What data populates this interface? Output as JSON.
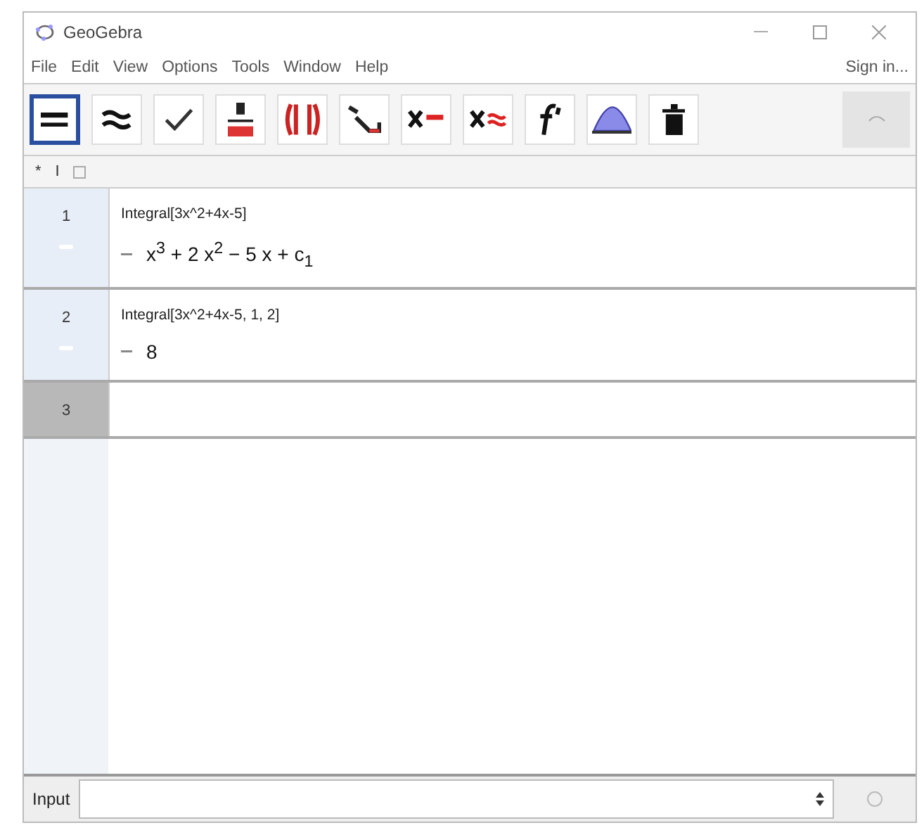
{
  "window": {
    "title": "GeoGebra"
  },
  "menu": [
    "File",
    "Edit",
    "View",
    "Options",
    "Tools",
    "Window",
    "Help"
  ],
  "sign_in": "Sign in...",
  "toolbar": [
    {
      "kind": "evaluate",
      "selected": true
    },
    {
      "kind": "numeric",
      "selected": false
    },
    {
      "kind": "keep",
      "selected": false
    },
    {
      "kind": "factor",
      "selected": false
    },
    {
      "kind": "expand",
      "selected": false
    },
    {
      "kind": "substitute",
      "selected": false
    },
    {
      "kind": "solve",
      "selected": false
    },
    {
      "kind": "nsolve",
      "selected": false
    },
    {
      "kind": "derivative",
      "selected": false
    },
    {
      "kind": "integral",
      "selected": false
    },
    {
      "kind": "delete",
      "selected": false
    }
  ],
  "format_bar": [
    "*",
    "I"
  ],
  "rows": [
    {
      "number": "1",
      "input": "Integral[3x^2+4x-5]",
      "output": "x$^{3}$ + 2 x$^{2}$ − 5 x + c$_{1}$",
      "selected": false
    },
    {
      "number": "2",
      "input": "Integral[3x^2+4x-5, 1, 2]",
      "output": "8",
      "selected": false
    },
    {
      "number": "3",
      "selected": true
    }
  ],
  "input_bar": {
    "label": "Input"
  }
}
